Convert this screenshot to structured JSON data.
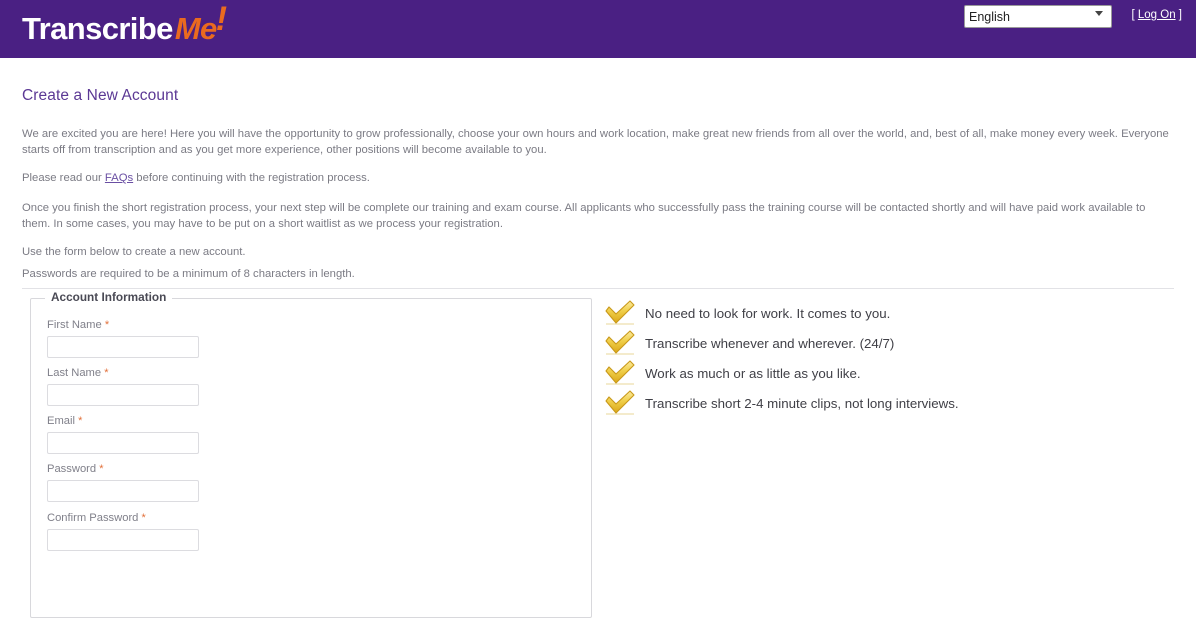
{
  "header": {
    "logo": {
      "part1": "Transcribe",
      "part2": "Me",
      "part3": "!"
    },
    "language_select": {
      "selected": "English",
      "options": [
        "English"
      ]
    },
    "logon_open": "[ ",
    "logon_label": "Log On",
    "logon_close": " ]"
  },
  "main": {
    "title": "Create a New Account",
    "paragraph1": "We are excited you are here! Here you will have the opportunity to grow professionally, choose your own hours and work location, make great new friends from all over the world, and, best of all, make money every week. Everyone starts off from transcription and as you get more experience, other positions will become available to you.",
    "paragraph2_before": "Please read our ",
    "paragraph2_link": "FAQs",
    "paragraph2_after": " before continuing with the registration process.",
    "paragraph3": "Once you finish the short registration process, your next step will be complete our training and exam course. All applicants who successfully pass the training course will be contacted shortly and will have paid work available to them. In some cases, you may have to be put on a short waitlist as we process your registration.",
    "paragraph4": "Use the form below to create a new account.",
    "paragraph5": "Passwords are required to be a minimum of 8 characters in length."
  },
  "form": {
    "legend": "Account Information",
    "required_marker": "*",
    "fields": [
      {
        "label": "First Name",
        "value": "",
        "placeholder": "",
        "required": true
      },
      {
        "label": "Last Name",
        "value": "",
        "placeholder": "",
        "required": true
      },
      {
        "label": "Email",
        "value": "",
        "placeholder": "",
        "required": true
      },
      {
        "label": "Password",
        "value": "",
        "placeholder": "",
        "required": true
      },
      {
        "label": "Confirm Password",
        "value": "",
        "placeholder": "",
        "required": true
      }
    ]
  },
  "benefits": {
    "icon": "gold-checkmark-icon",
    "items": [
      "No need to look for work. It comes to you.",
      "Transcribe whenever and wherever. (24/7)",
      "Work as much or as little as you like.",
      "Transcribe short 2-4 minute clips, not long interviews."
    ]
  },
  "colors": {
    "header_purple": "#4a2083",
    "accent_orange": "#ea6a1f",
    "title_purple": "#5b3894",
    "check_gold": "#e8bf2d",
    "required_asterisk": "#e2703a",
    "body_text": "#7b7b84"
  }
}
